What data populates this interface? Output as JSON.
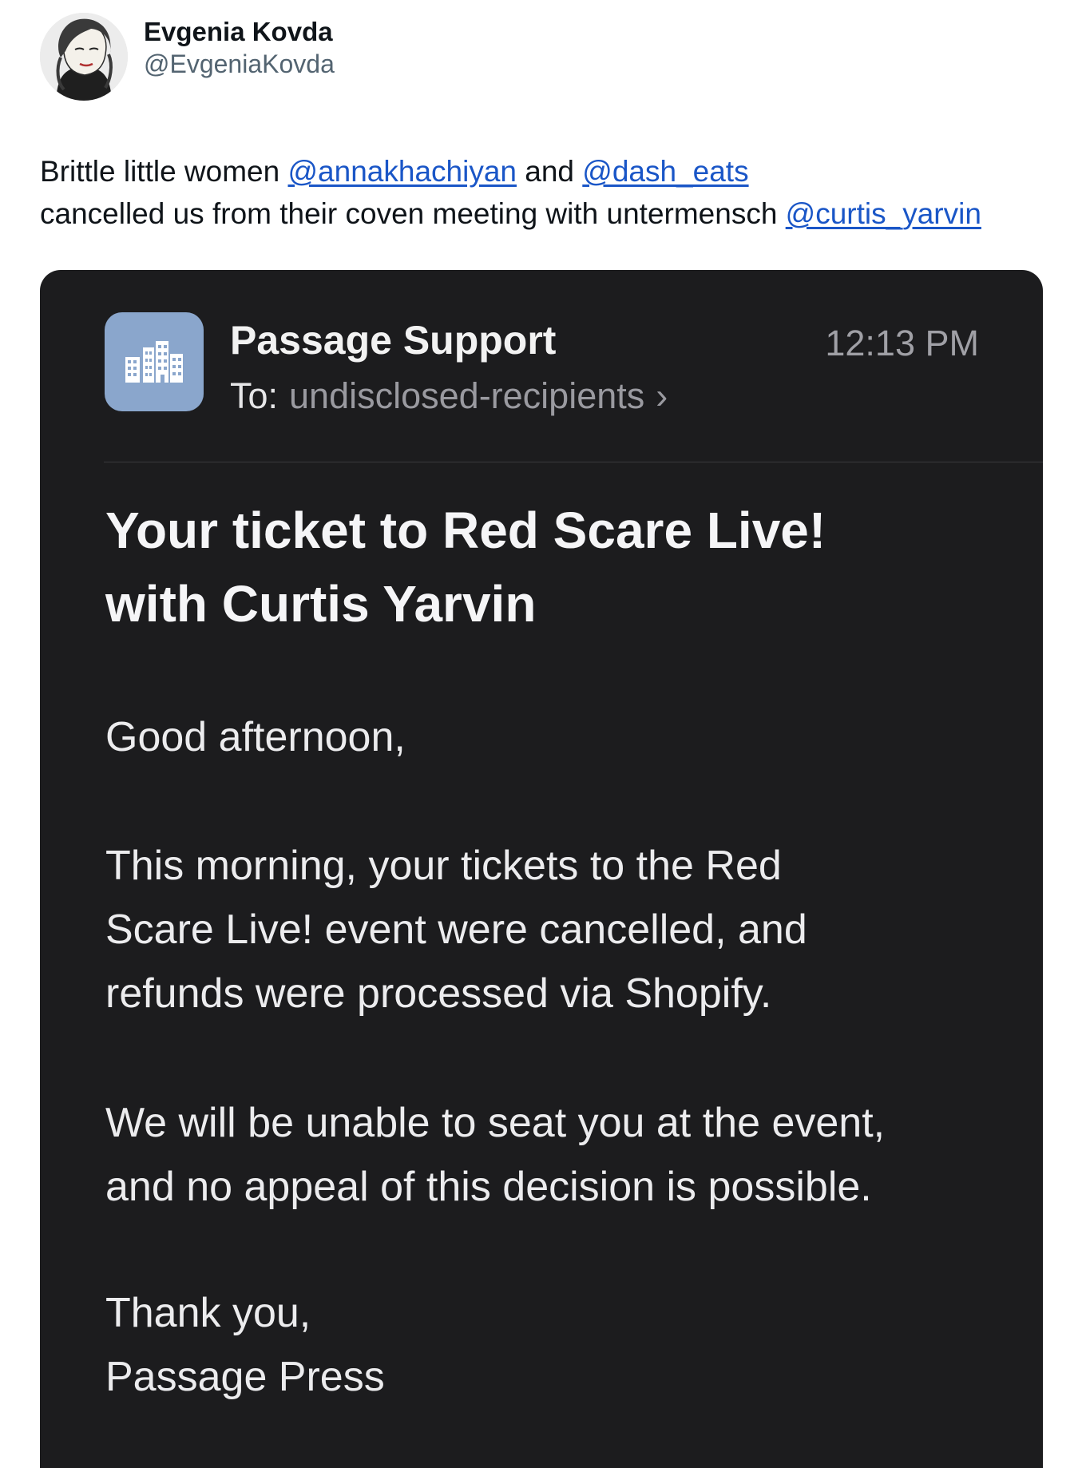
{
  "author": {
    "display_name": "Evgenia Kovda",
    "handle": "@EvgeniaKovda"
  },
  "tweet": {
    "line1_before": "Brittle little women ",
    "mention1": "@annakhachiyan",
    "line1_middle": " and ",
    "mention2": "@dash_eats",
    "line2_before": "cancelled us from their coven meeting with untermensch ",
    "mention3": "@curtis_yarvin"
  },
  "email": {
    "sender": "Passage Support",
    "time": "12:13 PM",
    "to_label": "To:",
    "to_value": "undisclosed-recipients",
    "chevron": "›",
    "subject_lines": [
      "Your ticket to Red Scare Live!",
      "with Curtis Yarvin"
    ],
    "greeting": "Good afternoon,",
    "paragraph1": [
      "This morning, your tickets to the Red",
      "Scare Live! event were cancelled, and",
      "refunds were processed via Shopify."
    ],
    "paragraph2": [
      "We will be unable to seat you at the event,",
      "and no appeal of this decision is possible."
    ],
    "signoff": [
      "Thank you,",
      "Passage Press"
    ],
    "sender_icon_name": "building-icon",
    "sender_icon_color": "#8aa6cc"
  },
  "colors": {
    "mention": "#1a56c7",
    "email_background": "#1c1c1e",
    "handle": "#536471"
  }
}
